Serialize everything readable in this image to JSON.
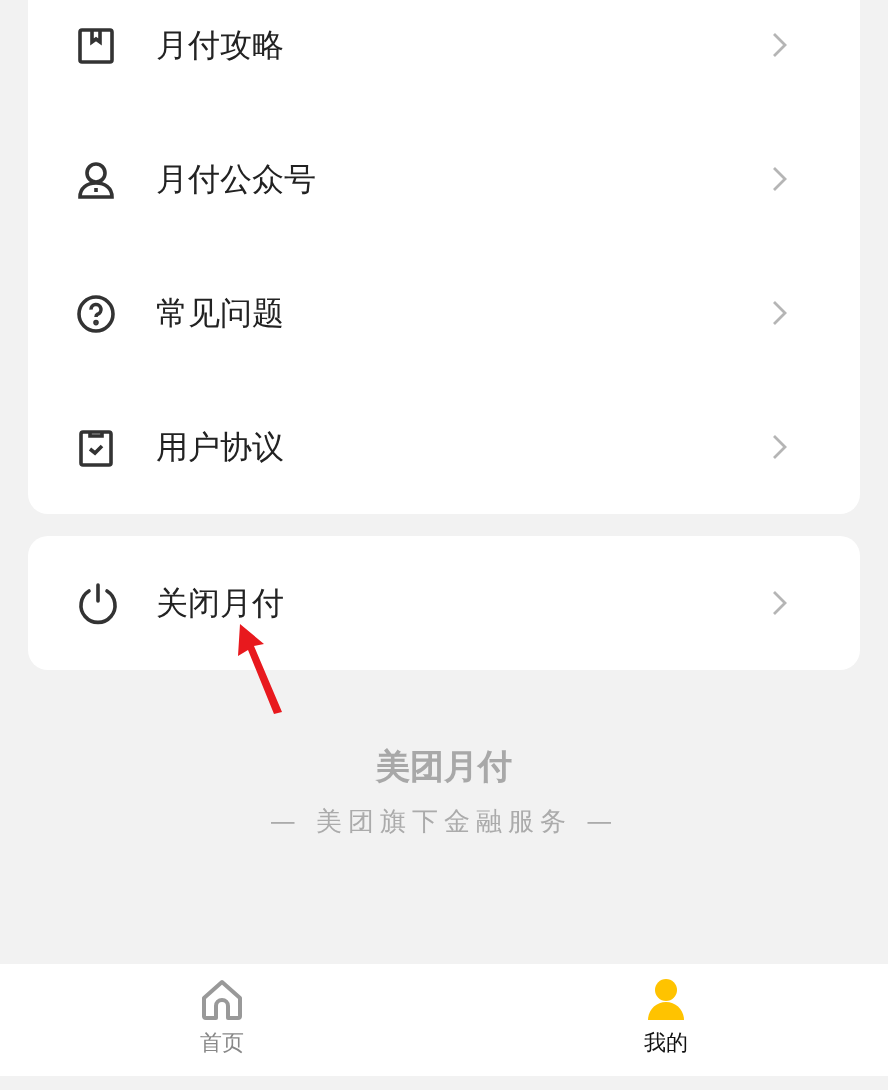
{
  "menu_items": [
    {
      "kind": "book",
      "label": "月付攻略"
    },
    {
      "kind": "person",
      "label": "月付公众号"
    },
    {
      "kind": "help",
      "label": "常见问题"
    },
    {
      "kind": "agreement",
      "label": "用户协议"
    }
  ],
  "close_item": {
    "kind": "power",
    "label": "关闭月付"
  },
  "footer": {
    "brand": "美团月付",
    "tagline": "— 美团旗下金融服务 —"
  },
  "tab_bar": [
    {
      "kind": "home",
      "label": "首页",
      "selected": false
    },
    {
      "kind": "me",
      "label": "我的",
      "selected": true
    }
  ]
}
